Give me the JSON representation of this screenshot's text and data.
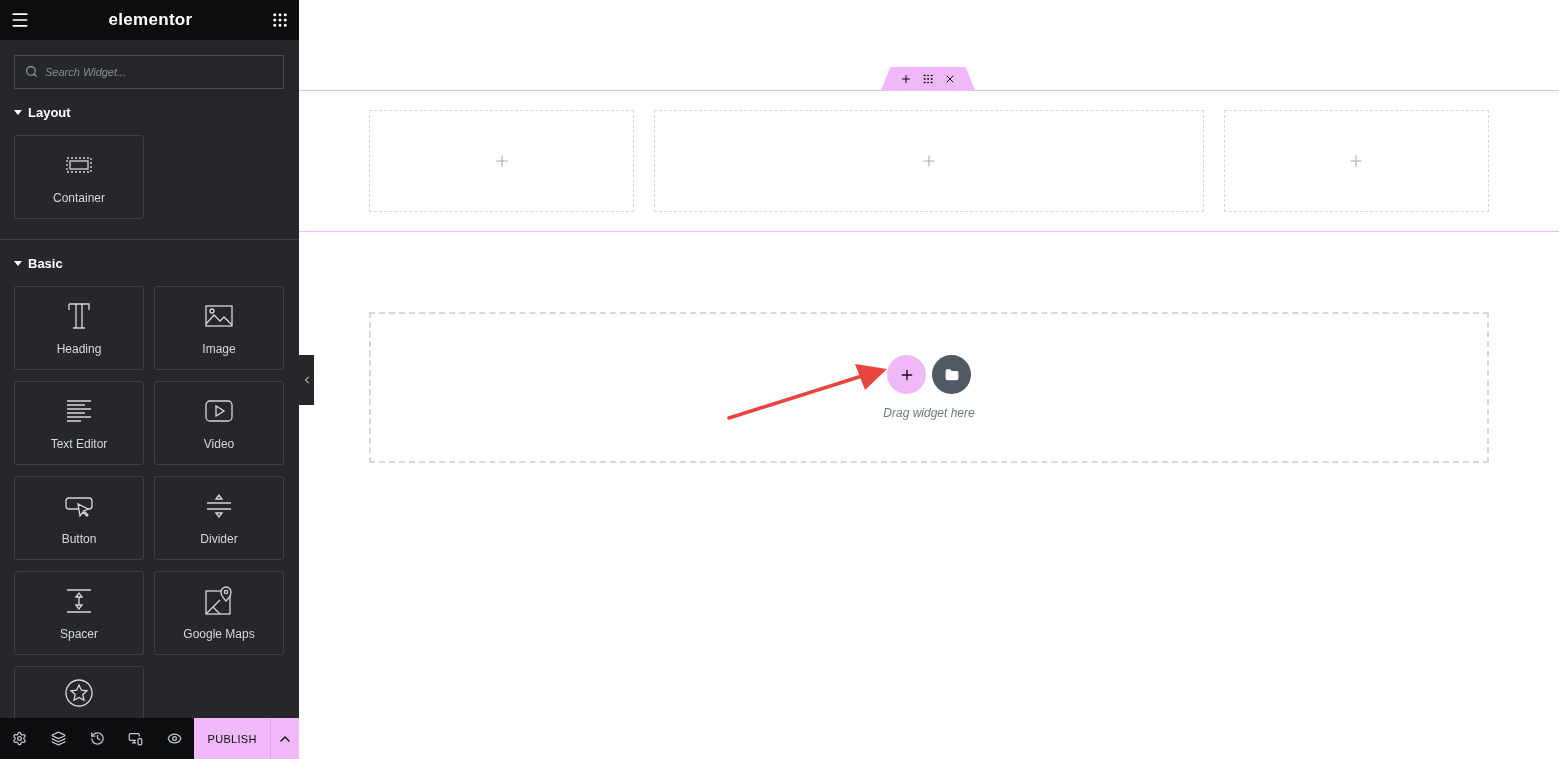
{
  "sidebar": {
    "logo": "elementor",
    "search": {
      "placeholder": "Search Widget..."
    },
    "categories": [
      {
        "title": "Layout",
        "expanded": true,
        "widgets": [
          {
            "label": "Container"
          }
        ]
      },
      {
        "title": "Basic",
        "expanded": true,
        "widgets": [
          {
            "label": "Heading"
          },
          {
            "label": "Image"
          },
          {
            "label": "Text Editor"
          },
          {
            "label": "Video"
          },
          {
            "label": "Button"
          },
          {
            "label": "Divider"
          },
          {
            "label": "Spacer"
          },
          {
            "label": "Google Maps"
          },
          {
            "cut_off": true
          }
        ]
      }
    ]
  },
  "footer": {
    "publish": "PUBLISH"
  },
  "canvas": {
    "drop_zone": {
      "hint": "Drag widget here"
    }
  }
}
